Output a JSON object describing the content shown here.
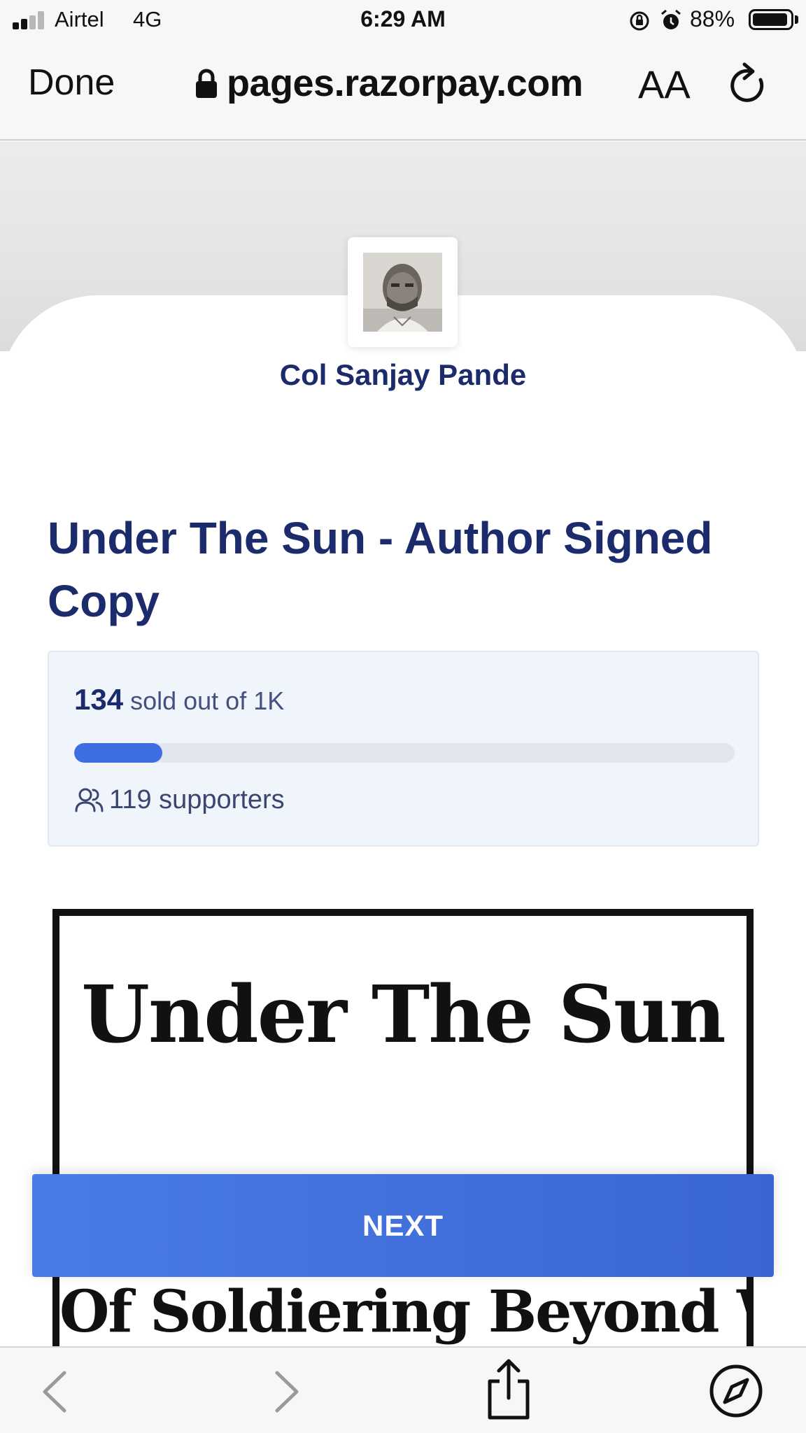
{
  "status_bar": {
    "carrier": "Airtel",
    "network": "4G",
    "time": "6:29 AM",
    "battery_percent": "88%",
    "icons": [
      "signal-icon",
      "orientation-lock-icon",
      "alarm-icon",
      "battery-icon"
    ]
  },
  "browser": {
    "done_label": "Done",
    "url": "pages.razorpay.com",
    "text_size_label": "AA",
    "icons": [
      "lock-icon",
      "reload-icon"
    ]
  },
  "page": {
    "merchant_name": "Col Sanjay Pande",
    "product_title": "Under The Sun - Author Signed Copy",
    "stats": {
      "sold_count": "134",
      "sold_suffix": "sold out of 1K",
      "progress_fraction": 0.134,
      "supporters_label": "119 supporters"
    },
    "cover": {
      "title": "Under The Sun",
      "subtitle": "Of Soldiering Beyond War"
    },
    "next_label": "NEXT"
  },
  "bottom_bar": {
    "icons": [
      "back-icon",
      "forward-icon",
      "share-icon",
      "compass-icon"
    ]
  },
  "colors": {
    "brand_navy": "#1b2b6b",
    "accent_blue": "#3f6ee0",
    "stats_bg": "#f0f4fb"
  }
}
